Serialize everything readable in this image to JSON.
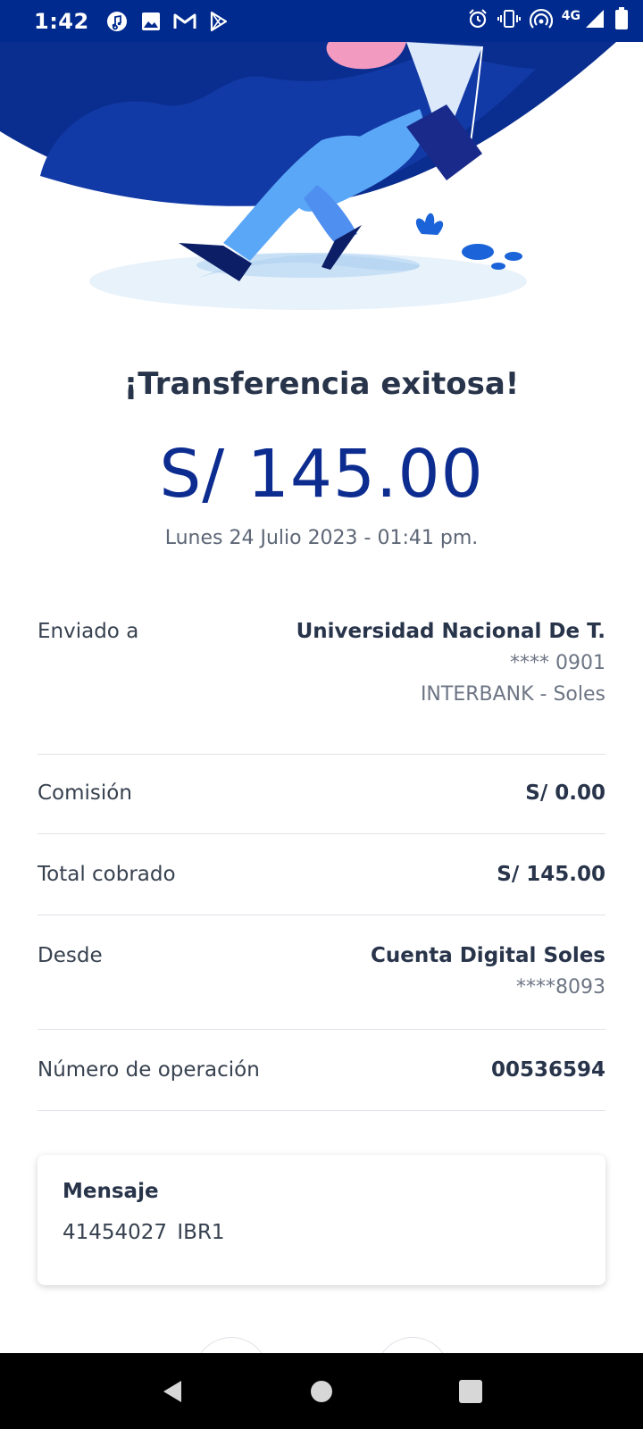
{
  "status_bar": {
    "time": "1:42",
    "network": "4G",
    "icons": [
      "music-icon",
      "image-icon",
      "gmail-icon",
      "play-store-icon",
      "alarm-icon",
      "vibrate-icon",
      "hotspot-icon",
      "signal-icon",
      "battery-icon"
    ]
  },
  "receipt": {
    "title": "¡Transferencia exitosa!",
    "amount": "S/ 145.00",
    "date": "Lunes 24 Julio 2023 - 01:41 pm."
  },
  "details": {
    "sent_to": {
      "label": "Enviado a",
      "name": "Universidad Nacional De T.",
      "account": "**** 0901",
      "bank": "INTERBANK - Soles"
    },
    "commission": {
      "label": "Comisión",
      "value": "S/ 0.00"
    },
    "total": {
      "label": "Total cobrado",
      "value": "S/ 145.00"
    },
    "from": {
      "label": "Desde",
      "account_name": "Cuenta Digital Soles",
      "account": "****8093"
    },
    "operation": {
      "label": "Número de operación",
      "value": "00536594"
    }
  },
  "message": {
    "title": "Mensaje",
    "text": "41454027  IBR1"
  },
  "colors": {
    "brand_blue": "#002a8d",
    "amount_blue": "#0c2c8f"
  },
  "nav": {
    "icons": [
      "back-icon",
      "home-icon",
      "recents-icon"
    ]
  }
}
